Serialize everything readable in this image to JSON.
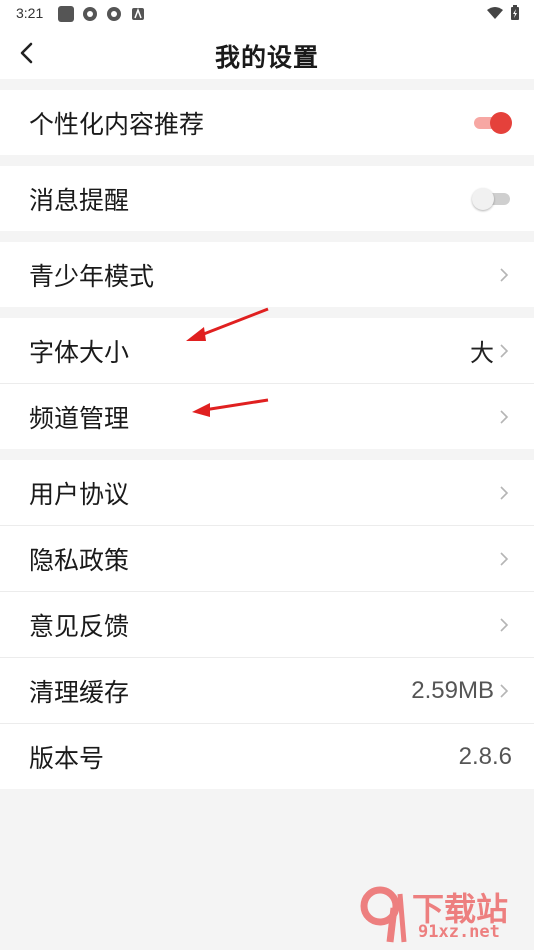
{
  "status_bar": {
    "time": "3:21"
  },
  "header": {
    "title": "我的设置"
  },
  "groups": [
    {
      "items": [
        {
          "label": "个性化内容推荐",
          "control": "toggle",
          "toggle_state": "on"
        }
      ]
    },
    {
      "items": [
        {
          "label": "消息提醒",
          "control": "toggle",
          "toggle_state": "off"
        }
      ]
    },
    {
      "items": [
        {
          "label": "青少年模式",
          "control": "chevron"
        }
      ]
    },
    {
      "items": [
        {
          "label": "字体大小",
          "value": "大",
          "control": "chevron"
        },
        {
          "label": "频道管理",
          "control": "chevron"
        }
      ]
    },
    {
      "items": [
        {
          "label": "用户协议",
          "control": "chevron"
        },
        {
          "label": "隐私政策",
          "control": "chevron"
        },
        {
          "label": "意见反馈",
          "control": "chevron"
        },
        {
          "label": "清理缓存",
          "value": "2.59MB",
          "control": "chevron"
        },
        {
          "label": "版本号",
          "value": "2.8.6",
          "control": "none"
        }
      ]
    }
  ],
  "watermark": {
    "text_cn": "下载站",
    "text_url": "91xz.net"
  },
  "colors": {
    "accent": "#e5413b",
    "annotation_arrow": "#e02020",
    "background": "#f4f4f4"
  }
}
